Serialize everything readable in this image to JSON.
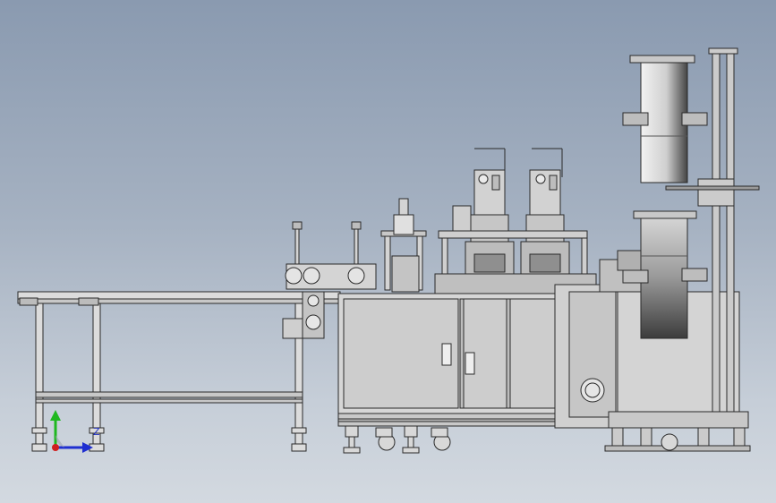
{
  "viewport": {
    "background_top": "#8a9ab0",
    "background_bottom": "#d3d9e0"
  },
  "model": {
    "line_color": "#2a2a2a",
    "body_fill": "#d9d9d9",
    "panel_fill": "#c9c9c9",
    "roll_dark": "#3a3a3a",
    "roll_light": "#e8e8e8"
  },
  "triad": {
    "x_axis_color": "#1f2fd0",
    "y_axis_color": "#1fb81f",
    "z_axis_color": "#d01f1f",
    "z_label": "Z"
  }
}
